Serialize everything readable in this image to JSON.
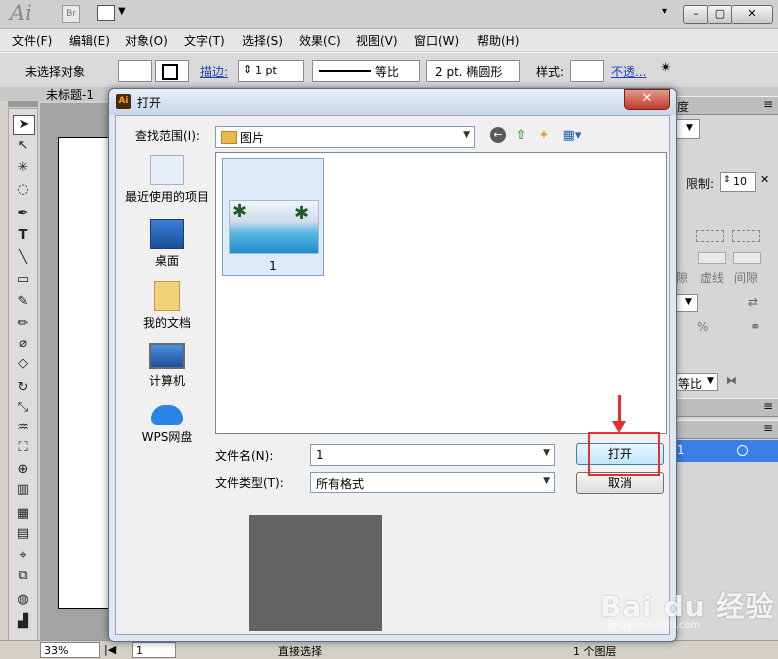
{
  "app": {
    "logo": "Ai",
    "bridge_badge": "Br",
    "window_controls": [
      "▾",
      "–",
      "▢",
      "✕"
    ]
  },
  "menubar": {
    "items": [
      "文件(F)",
      "编辑(E)",
      "对象(O)",
      "文字(T)",
      "选择(S)",
      "效果(C)",
      "视图(V)",
      "窗口(W)",
      "帮助(H)"
    ]
  },
  "control_bar": {
    "selection_status": "未选择对象",
    "stroke_label": "描边:",
    "stroke_weight": "1 pt",
    "profile_label": "等比",
    "brush_size": "2 pt. 椭圆形",
    "style_label": "样式:",
    "opacity_label": "不透..."
  },
  "document": {
    "tab_title": "未标题-1"
  },
  "right_panel": {
    "header_fragment": "度",
    "limit_label": "限制:",
    "limit_value": "10",
    "dashed_label": "虚线",
    "gap_label": "间隙",
    "gap_label_partial": "隙",
    "percent": "%",
    "profile_value": "等比",
    "layer_number": "1"
  },
  "dialog": {
    "title": "打开",
    "app_icon_label": "Ai",
    "close_label": "✕",
    "look_in_label": "查找范围(I):",
    "look_in_value": "图片",
    "places": [
      "最近使用的项目",
      "桌面",
      "我的文档",
      "计算机",
      "WPS网盘"
    ],
    "files": [
      {
        "name": "1"
      }
    ],
    "filename_label": "文件名(N):",
    "filename_value": "1",
    "filetype_label": "文件类型(T):",
    "filetype_value": "所有格式",
    "open_button": "打开",
    "cancel_button": "取消"
  },
  "status_bar": {
    "zoom": "33%",
    "page": "1",
    "tool_name": "直接选择",
    "layer_count": "1 个图层"
  },
  "watermark": {
    "brand": "Bai du 经验",
    "url": "jingyan.baidu.com"
  },
  "colors": {
    "annotation_red": "#e3302e",
    "layer_selection": "#3a7ee8",
    "link_blue": "#2042b8"
  }
}
